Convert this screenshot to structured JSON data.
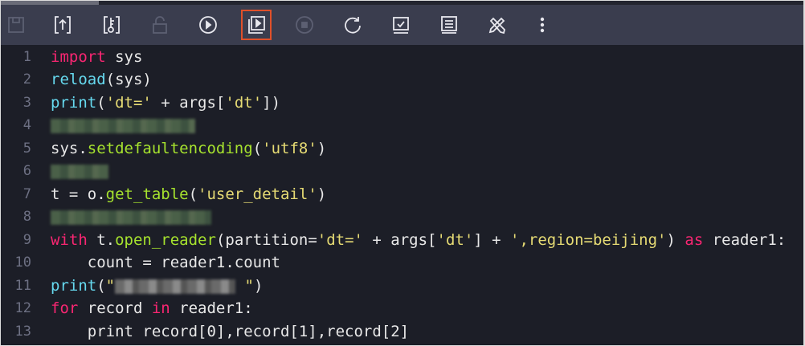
{
  "toolbar": {
    "buttons": [
      {
        "name": "save-icon",
        "enabled": false
      },
      {
        "name": "upload-icon",
        "enabled": true
      },
      {
        "name": "key-icon",
        "enabled": true
      },
      {
        "name": "lock-icon",
        "enabled": false
      },
      {
        "name": "run-icon",
        "enabled": true
      },
      {
        "name": "run-with-params-icon",
        "enabled": true,
        "selected": true
      },
      {
        "name": "stop-icon",
        "enabled": false
      },
      {
        "name": "refresh-icon",
        "enabled": true
      },
      {
        "name": "submit-icon",
        "enabled": true
      },
      {
        "name": "format-icon",
        "enabled": true
      },
      {
        "name": "tools-icon",
        "enabled": true
      },
      {
        "name": "more-icon",
        "enabled": true
      }
    ]
  },
  "editor": {
    "line_numbers": [
      "1",
      "2",
      "3",
      "4",
      "5",
      "6",
      "7",
      "8",
      "9",
      "10",
      "11",
      "12",
      "13"
    ],
    "l1": {
      "kw": "import",
      "rest": " sys"
    },
    "l2": {
      "fn": "reload",
      "rest": "(sys)"
    },
    "l3": {
      "fn": "print",
      "a": "(",
      "s1": "'dt='",
      "b": " + args[",
      "s2": "'dt'",
      "c": "])"
    },
    "l5": {
      "a": "sys.",
      "m": "setdefaultencoding",
      "b": "(",
      "s": "'utf8'",
      "c": ")"
    },
    "l7": {
      "a": "t = o.",
      "m": "get_table",
      "b": "(",
      "s": "'user_detail'",
      "c": ")"
    },
    "l9": {
      "kw": "with",
      "a": " t.",
      "m": "open_reader",
      "b": "(partition=",
      "s1": "'dt='",
      "c": " + args[",
      "s2": "'dt'",
      "d": "] + ",
      "s3": "',region=beijing'",
      "e": ") ",
      "kw2": "as",
      "f": " reader1:"
    },
    "l10": {
      "text": "    count = reader1.count"
    },
    "l11": {
      "fn": "print",
      "a": "(",
      "q1": "\"",
      "q2": " \"",
      "b": ")"
    },
    "l12": {
      "kw": "for",
      "a": " record ",
      "kw2": "in",
      "b": " reader1:"
    },
    "l13": {
      "text": "    print record[0],record[1],record[2]"
    }
  }
}
